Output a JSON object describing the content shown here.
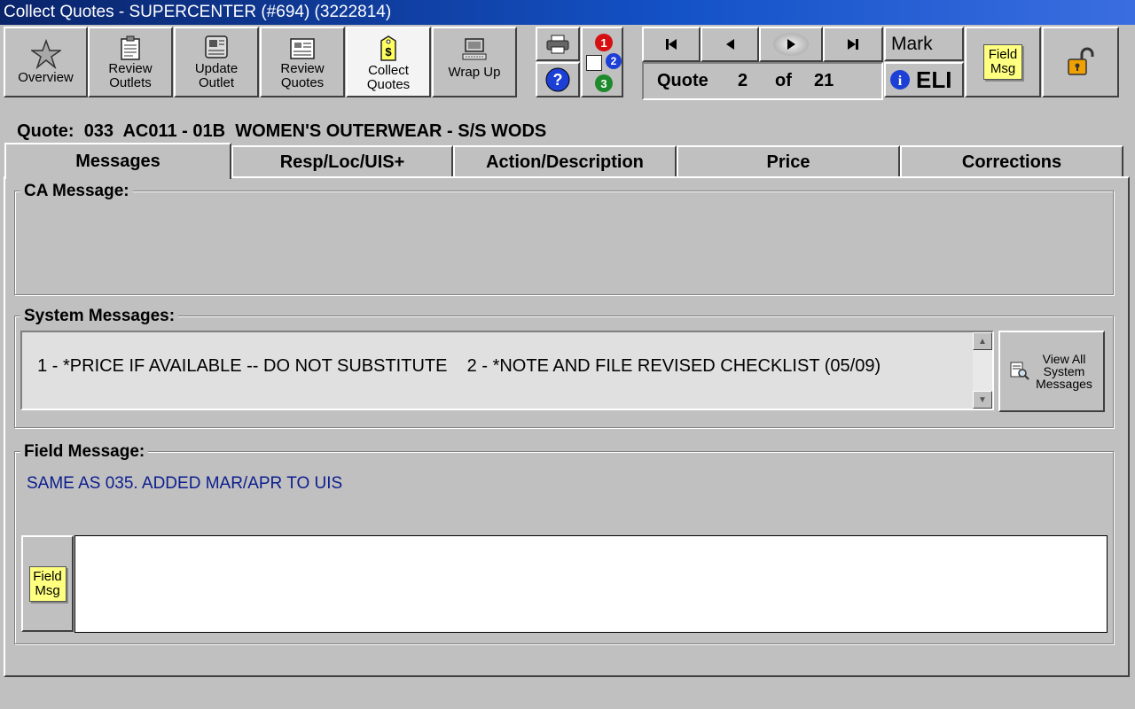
{
  "window": {
    "title": "Collect Quotes -  SUPERCENTER (#694) (3222814)"
  },
  "toolbar": {
    "buttons": [
      {
        "label": "Overview",
        "icon": "star-icon"
      },
      {
        "label": "Review Outlets",
        "icon": "clipboard-icon"
      },
      {
        "label": "Update Outlet",
        "icon": "newspaper-icon"
      },
      {
        "label": "Review Quotes",
        "icon": "document-grid-icon"
      },
      {
        "label": "Collect Quotes",
        "icon": "money-tag-icon"
      },
      {
        "label": "Wrap Up",
        "icon": "computer-icon"
      }
    ],
    "print_icon": "printer-icon",
    "help_icon": "help-icon",
    "sequence_badges": [
      "1",
      "2",
      "3"
    ]
  },
  "navigation": {
    "mark_label": "Mark",
    "eli_label": "ELI",
    "quote_label": "Quote",
    "current": "2",
    "of_label": "of",
    "total": "21",
    "field_msg_label": "Field Msg"
  },
  "quote_header": {
    "label": "Quote:",
    "number": "033",
    "code": "AC011 - 01B",
    "description": "WOMEN'S OUTERWEAR - S/S WODS"
  },
  "tabs": [
    {
      "label": "Messages",
      "active": true
    },
    {
      "label": "Resp/Loc/UIS+",
      "active": false
    },
    {
      "label": "Action/Description",
      "active": false
    },
    {
      "label": "Price",
      "active": false
    },
    {
      "label": "Corrections",
      "active": false
    }
  ],
  "ca_message": {
    "label": "CA Message:",
    "text": ""
  },
  "system_messages": {
    "label": "System Messages:",
    "text": "1 - *PRICE IF AVAILABLE -- DO NOT SUBSTITUTE    2 - *NOTE AND FILE REVISED CHECKLIST (05/09)",
    "view_all_label": "View All System Messages"
  },
  "field_message": {
    "label": "Field Message:",
    "text": "SAME AS 035. ADDED MAR/APR TO UIS",
    "input_value": "",
    "button_label": "Field Msg"
  },
  "colors": {
    "title_bar": "#0a246a",
    "background": "#c0c0c0",
    "field_message_text": "#0b1d8e",
    "note_yellow": "#ffff80"
  }
}
